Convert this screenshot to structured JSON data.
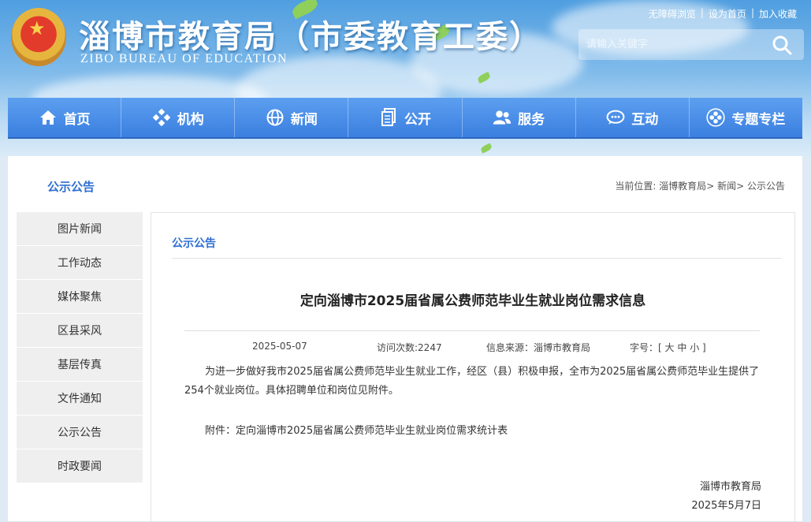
{
  "site": {
    "title": "淄博市教育局（市委教育工委）",
    "subtitle": "ZIBO BUREAU OF EDUCATION"
  },
  "toplinks": [
    "无障碍浏览",
    "设为首页",
    "加入收藏"
  ],
  "search": {
    "placeholder": "请输入关键字"
  },
  "nav": [
    {
      "label": "首页",
      "icon": "home-icon"
    },
    {
      "label": "机构",
      "icon": "org-icon"
    },
    {
      "label": "新闻",
      "icon": "globe-icon"
    },
    {
      "label": "公开",
      "icon": "document-icon"
    },
    {
      "label": "服务",
      "icon": "users-icon"
    },
    {
      "label": "互动",
      "icon": "chat-icon"
    },
    {
      "label": "专题专栏",
      "icon": "topic-icon"
    }
  ],
  "section_title": "公示公告",
  "breadcrumb": {
    "prefix": "当前位置: ",
    "items": [
      "淄博教育局",
      "新闻",
      "公示公告"
    ],
    "sep": ">"
  },
  "sidebar": [
    "图片新闻",
    "工作动态",
    "媒体聚焦",
    "区县采风",
    "基层传真",
    "文件通知",
    "公示公告",
    "时政要闻"
  ],
  "article": {
    "category": "公示公告",
    "title": "定向淄博市2025届省属公费师范毕业生就业岗位需求信息",
    "date": "2025-05-07",
    "visits": "访问次数:2247",
    "source": "信息来源：淄博市教育局",
    "fontsize_label": "字号：[",
    "fontsize_options": [
      "大",
      "中",
      "小"
    ],
    "fontsize_close": "]",
    "paragraph1": "为进一步做好我市2025届省属公费师范毕业生就业工作，经区（县）积极申报，全市为2025届省属公费师范毕业生提供了254个就业岗位。具体招聘单位和岗位见附件。",
    "attachment_prefix": "附件：",
    "attachment_link": "定向淄博市2025届省属公费师范毕业生就业岗位需求统计表",
    "signature_org": "淄博市教育局",
    "signature_date": "2025年5月7日"
  },
  "colors": {
    "accent": "#2f6fd2",
    "nav": "#4a8ee8"
  }
}
